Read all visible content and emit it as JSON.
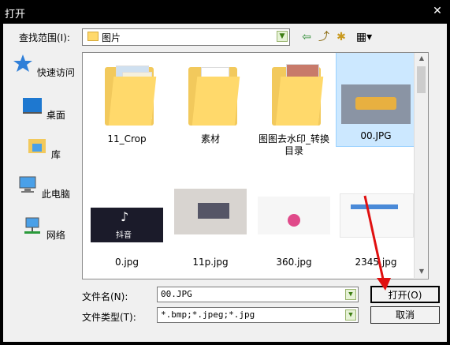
{
  "window": {
    "title": "打开",
    "close_glyph": "✕"
  },
  "lookin": {
    "label": "查找范围(I):",
    "value": "图片"
  },
  "places": [
    {
      "label": "快速访问",
      "icon": "star-icon"
    },
    {
      "label": "桌面",
      "icon": "desktop-icon"
    },
    {
      "label": "库",
      "icon": "library-icon"
    },
    {
      "label": "此电脑",
      "icon": "computer-icon"
    },
    {
      "label": "网络",
      "icon": "network-icon"
    }
  ],
  "files": [
    {
      "name": "11_Crop",
      "kind": "folder"
    },
    {
      "name": "素材",
      "kind": "folder"
    },
    {
      "name": "图图去水印_转换目录",
      "kind": "folder"
    },
    {
      "name": "00.JPG",
      "kind": "image",
      "selected": true
    },
    {
      "name": "0.jpg",
      "kind": "image"
    },
    {
      "name": "11p.jpg",
      "kind": "image"
    },
    {
      "name": "360.jpg",
      "kind": "image"
    },
    {
      "name": "2345.jpg",
      "kind": "image"
    }
  ],
  "thumb_text": {
    "tiktok": "抖音"
  },
  "filename": {
    "label": "文件名(N):",
    "value": "00.JPG"
  },
  "filetype": {
    "label": "文件类型(T):",
    "value": "*.bmp;*.jpeg;*.jpg"
  },
  "buttons": {
    "open": "打开(O)",
    "cancel": "取消"
  },
  "colors": {
    "accent_arrow": "#e01010",
    "folder": "#ffd96b",
    "selection": "#cce8ff"
  }
}
